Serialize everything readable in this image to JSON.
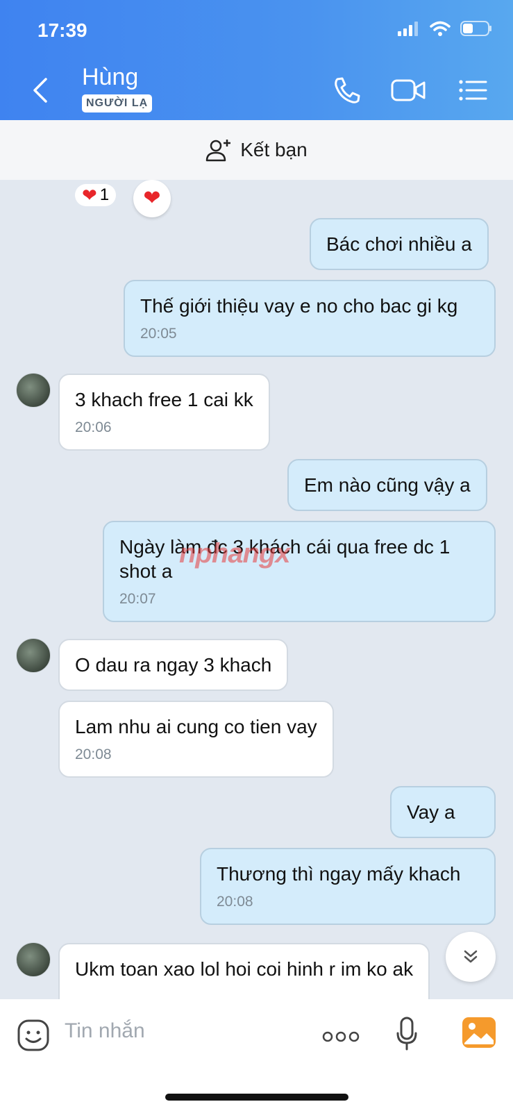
{
  "status": {
    "time": "17:39"
  },
  "header": {
    "name": "Hùng",
    "badge": "NGƯỜI LẠ"
  },
  "add_friend": {
    "label": "Kết bạn"
  },
  "reaction": {
    "count": "1"
  },
  "messages": [
    {
      "text": "Bác chơi nhiều a",
      "time": ""
    },
    {
      "text": "Thế giới thiệu vay e no cho bac gi kg",
      "time": "20:05"
    },
    {
      "text": "3 khach free 1 cai kk",
      "time": "20:06"
    },
    {
      "text": "Em nào cũng vậy a",
      "time": ""
    },
    {
      "text": "Ngày làm đc 3 khách cái qua free dc 1 shot a",
      "time": "20:07"
    },
    {
      "text": "O dau ra ngay 3 khach",
      "time": ""
    },
    {
      "text": "Lam nhu ai cung co tien vay",
      "time": "20:08"
    },
    {
      "text": "Vay a",
      "time": ""
    },
    {
      "text": "Thương thì ngay mấy khach",
      "time": "20:08"
    },
    {
      "text": "Ukm toan xao lol hoi coi hinh r im ko ak",
      "time": ""
    }
  ],
  "watermark": "nphangx",
  "input": {
    "placeholder": "Tin nhắn"
  },
  "icons": [
    "back-icon",
    "phone-icon",
    "video-icon",
    "menu-icon",
    "add-friend-icon",
    "heart-icon",
    "emoji-icon",
    "more-icon",
    "mic-icon",
    "image-icon",
    "chevron-down-icon"
  ],
  "colors": {
    "header": "#4a93ef",
    "outgoing": "#d4ecfb",
    "incoming": "#ffffff",
    "chat_bg": "#e2e8f0"
  }
}
